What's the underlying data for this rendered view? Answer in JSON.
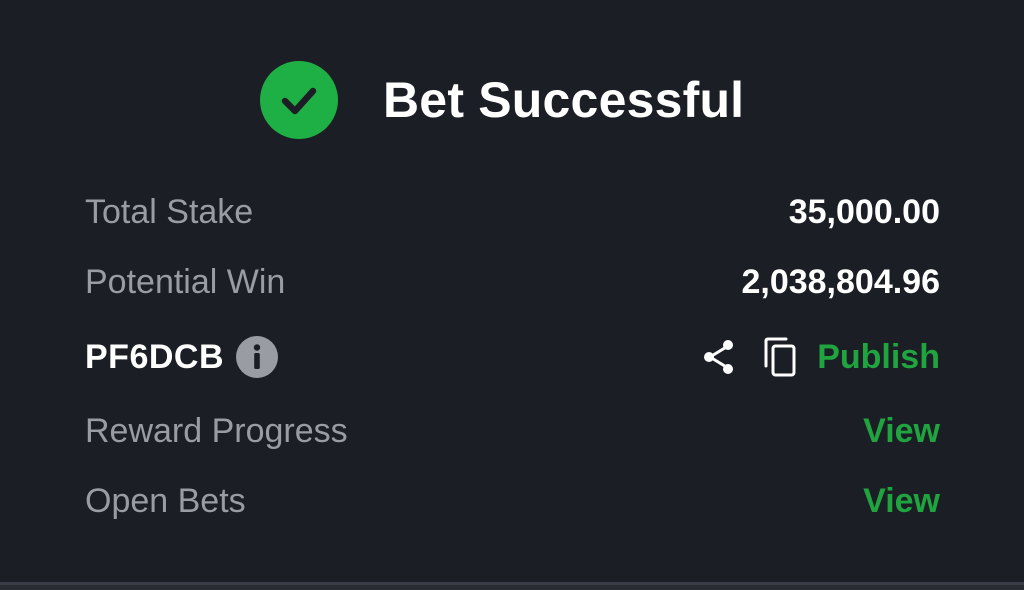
{
  "header": {
    "title": "Bet Successful",
    "icon": "check-circle-icon",
    "accent_color": "#1fb045"
  },
  "summary": {
    "total_stake_label": "Total Stake",
    "total_stake_value": "35,000.00",
    "potential_win_label": "Potential Win",
    "potential_win_value": "2,038,804.96"
  },
  "booking": {
    "code": "PF6DCB",
    "info_icon": "info-icon",
    "share_icon": "share-icon",
    "copy_icon": "copy-icon",
    "publish_label": "Publish"
  },
  "links": {
    "reward_progress_label": "Reward Progress",
    "reward_progress_action": "View",
    "open_bets_label": "Open Bets",
    "open_bets_action": "View",
    "link_color": "#1fa43f"
  }
}
